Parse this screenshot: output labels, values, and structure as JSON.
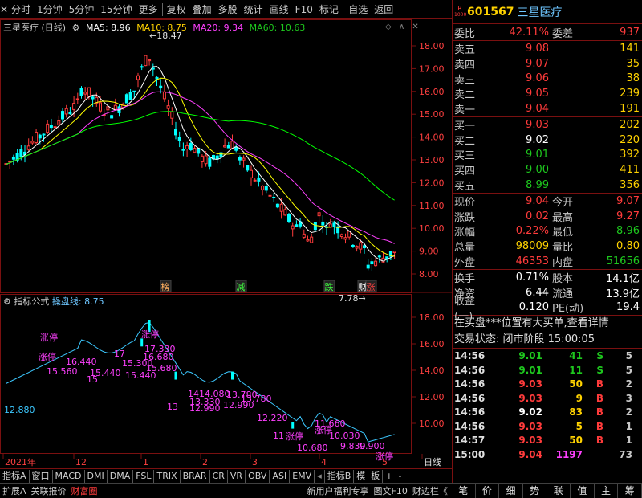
{
  "toolbar": {
    "items": [
      "分时",
      "1分钟",
      "5分钟",
      "15分钟",
      "更多",
      "复权",
      "叠加",
      "多股",
      "统计",
      "画线",
      "F10",
      "标记",
      "-自选",
      "返回"
    ]
  },
  "chart_title": "三星医疗 (日线)",
  "ma_legend": {
    "ma5": "MA5: 8.96",
    "ma10": "MA10: 8.75",
    "ma20": "MA20: 9.34",
    "ma60": "MA60: 10.63"
  },
  "price_axis": [
    "18.00",
    "17.00",
    "16.00",
    "15.00",
    "14.00",
    "13.00",
    "12.00",
    "11.00",
    "10.00",
    "9.00",
    "8.00"
  ],
  "indicator_axis": [
    "18.00",
    "16.00",
    "14.00",
    "12.00",
    "10.00"
  ],
  "annotations": {
    "high": "18.47",
    "low": "7.78",
    "markers": [
      "榜",
      "减",
      "跌",
      "财",
      "涨"
    ]
  },
  "indicator_legend": {
    "name": "指标公式",
    "line": "操盘线: 8.75"
  },
  "indicator_labels": [
    "涨停",
    "涨停",
    "16.440",
    "15.560",
    "15",
    "15.440",
    "17",
    "15.300",
    "15.440",
    "涨停",
    "17.330",
    "16.680",
    "15.680",
    "14",
    "14.080",
    "13",
    "13.330",
    "12.990",
    "13.780",
    "12.990",
    "13.780",
    "12.220",
    "11",
    "涨停",
    "10.680",
    "11.660",
    "涨停",
    "10.030",
    "9.830",
    "9.900",
    "涨停",
    "12.880"
  ],
  "date_axis": [
    "2021年",
    "12",
    "1",
    "2",
    "3",
    "4",
    "5",
    "日线"
  ],
  "tabs": [
    "指标A",
    "窗口",
    "MACD",
    "DMI",
    "DMA",
    "FSL",
    "TRIX",
    "BRAR",
    "CR",
    "VR",
    "OBV",
    "ASI",
    "EMV",
    "指标B",
    "模",
    "板",
    "+",
    "-"
  ],
  "statusbar": {
    "left": [
      "扩展A",
      "关联报价",
      "财富圈"
    ],
    "right": [
      "新用户福利专享",
      "图文F10",
      "财边栏《"
    ]
  },
  "panel": {
    "r_badge": "R",
    "r_sub": "1000",
    "code": "601567",
    "name": "三星医疗",
    "weibi": {
      "label": "委比",
      "value": "42.11%",
      "label2": "委差",
      "value2": "937"
    },
    "asks": [
      {
        "label": "卖五",
        "price": "9.08",
        "vol": "141"
      },
      {
        "label": "卖四",
        "price": "9.07",
        "vol": "35"
      },
      {
        "label": "卖三",
        "price": "9.06",
        "vol": "38"
      },
      {
        "label": "卖二",
        "price": "9.05",
        "vol": "239"
      },
      {
        "label": "卖一",
        "price": "9.04",
        "vol": "191"
      }
    ],
    "bids": [
      {
        "label": "买一",
        "price": "9.03",
        "vol": "202"
      },
      {
        "label": "买二",
        "price": "9.02",
        "vol": "220"
      },
      {
        "label": "买三",
        "price": "9.01",
        "vol": "392"
      },
      {
        "label": "买四",
        "price": "9.00",
        "vol": "411"
      },
      {
        "label": "买五",
        "price": "8.99",
        "vol": "356"
      }
    ],
    "quote": [
      {
        "l1": "现价",
        "v1": "9.04",
        "l2": "今开",
        "v2": "9.07"
      },
      {
        "l1": "涨跌",
        "v1": "0.02",
        "l2": "最高",
        "v2": "9.27"
      },
      {
        "l1": "涨幅",
        "v1": "0.22%",
        "l2": "最低",
        "v2": "8.96"
      },
      {
        "l1": "总量",
        "v1": "98009",
        "l2": "量比",
        "v2": "0.80"
      },
      {
        "l1": "外盘",
        "v1": "46353",
        "l2": "内盘",
        "v2": "51656"
      }
    ],
    "stats": [
      {
        "l1": "换手",
        "v1": "0.71%",
        "l2": "股本",
        "v2": "14.1亿"
      },
      {
        "l1": "净资",
        "v1": "6.44",
        "l2": "流通",
        "v2": "13.9亿"
      },
      {
        "l1": "收益(一)",
        "v1": "0.120",
        "l2": "PE(动)",
        "v2": "19.4"
      }
    ],
    "notice": "在买盘***位置有大买单,查看详情",
    "trade_status": "交易状态: 闭市阶段 15:00:05",
    "trades": [
      {
        "t": "14:56",
        "p": "9.01",
        "vol": "41",
        "bs": "S",
        "n": "5"
      },
      {
        "t": "14:56",
        "p": "9.01",
        "vol": "11",
        "bs": "S",
        "n": "5"
      },
      {
        "t": "14:56",
        "p": "9.03",
        "vol": "50",
        "bs": "B",
        "n": "2"
      },
      {
        "t": "14:56",
        "p": "9.03",
        "vol": "9",
        "bs": "B",
        "n": "3"
      },
      {
        "t": "14:56",
        "p": "9.02",
        "vol": "83",
        "bs": "B",
        "n": "2"
      },
      {
        "t": "14:56",
        "p": "9.03",
        "vol": "5",
        "bs": "B",
        "n": "1"
      },
      {
        "t": "14:57",
        "p": "9.03",
        "vol": "50",
        "bs": "B",
        "n": "1"
      },
      {
        "t": "15:00",
        "p": "9.04",
        "vol": "1197",
        "bs": "",
        "n": "73"
      }
    ],
    "tabs": [
      "笔",
      "价",
      "细",
      "势",
      "联",
      "值",
      "主",
      "筹"
    ]
  },
  "colors": {
    "up": "#ff3b3b",
    "down": "#00ffff",
    "ma5": "#ffffff",
    "ma10": "#ffff00",
    "ma20": "#ff40ff",
    "ma60": "#00ff00",
    "border": "#7a1010"
  }
}
